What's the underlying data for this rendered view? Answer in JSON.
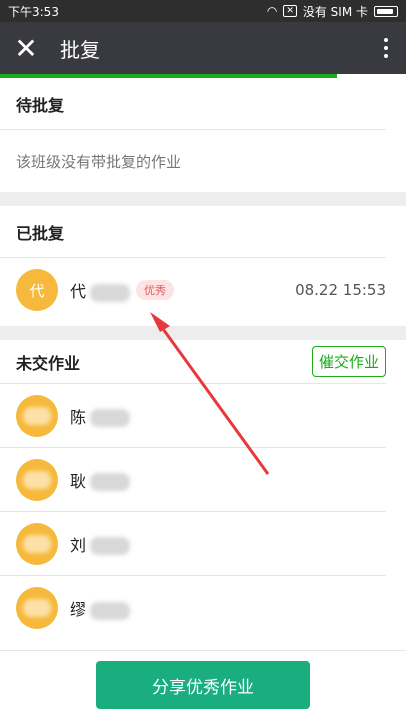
{
  "status_bar": {
    "time": "下午3:53",
    "carrier": "没有 SIM 卡"
  },
  "nav": {
    "title": "批复"
  },
  "progress": {
    "fraction": 0.83
  },
  "pending": {
    "title": "待批复",
    "empty_message": "该班级没有带批复的作业"
  },
  "reviewed": {
    "title": "已批复",
    "items": [
      {
        "avatar_text": "代",
        "name": "代",
        "badge": "优秀",
        "time": "08.22 15:53"
      }
    ]
  },
  "not_submitted": {
    "title": "未交作业",
    "urge_label": "催交作业",
    "items": [
      {
        "avatar_text": "",
        "name": "陈"
      },
      {
        "avatar_text": "",
        "name": "耿"
      },
      {
        "avatar_text": "",
        "name": "刘"
      },
      {
        "avatar_text": "",
        "name": "缪"
      }
    ]
  },
  "footer": {
    "share_label": "分享优秀作业"
  },
  "colors": {
    "accent": "#1aad19",
    "share_button": "#1aad7e",
    "avatar": "#f6b93b",
    "arrow": "#e8383d"
  }
}
